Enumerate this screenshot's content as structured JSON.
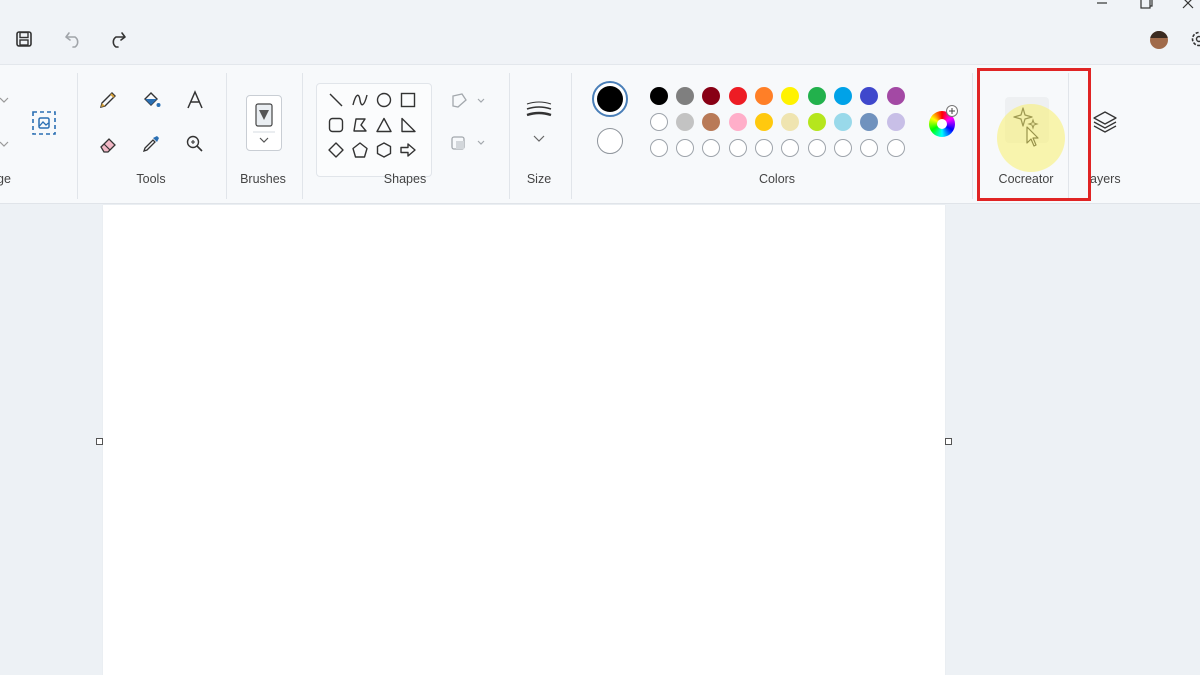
{
  "ribbon": {
    "groups": {
      "image_partial": "ge",
      "tools": "Tools",
      "brushes": "Brushes",
      "shapes": "Shapes",
      "size": "Size",
      "colors": "Colors",
      "cocreator": "Cocreator",
      "layers_partial": "ayers"
    }
  },
  "colors": {
    "primary": "#000000",
    "secondary": "#ffffff",
    "palette_row1": [
      "#000000",
      "#7f7f7f",
      "#880015",
      "#ed1c24",
      "#ff7f27",
      "#fff200",
      "#22b14c",
      "#00a2e8",
      "#3f48cc",
      "#a349a4"
    ],
    "palette_row2": [
      "#ffffff",
      "#c3c3c3",
      "#b97a57",
      "#ffaec9",
      "#ffc90e",
      "#efe4b0",
      "#b5e61d",
      "#99d9ea",
      "#7092be",
      "#c8bfe7"
    ],
    "highlight": "#e02424"
  },
  "icons": {
    "titlebar": [
      "save-icon",
      "undo-icon",
      "redo-icon",
      "avatar",
      "settings-icon"
    ],
    "tools": [
      "pencil-icon",
      "fill-icon",
      "text-icon",
      "eraser-icon",
      "color-picker-icon",
      "magnifier-icon"
    ],
    "shapes": [
      "line",
      "curve",
      "oval",
      "rectangle",
      "rounded-rectangle",
      "polygon",
      "triangle",
      "right-triangle",
      "diamond",
      "pentagon",
      "hexagon",
      "right-arrow"
    ]
  }
}
